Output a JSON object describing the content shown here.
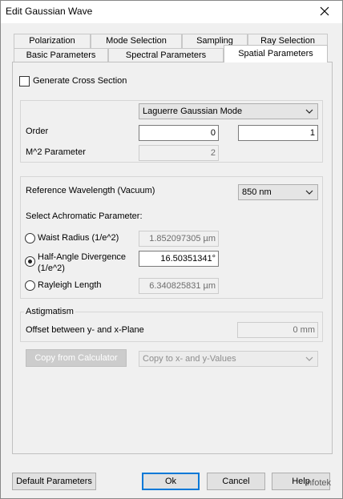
{
  "window": {
    "title": "Edit Gaussian Wave"
  },
  "tabs": {
    "row1": [
      "Polarization",
      "Mode Selection",
      "Sampling",
      "Ray Selection"
    ],
    "row2": [
      "Basic Parameters",
      "Spectral Parameters",
      "Spatial Parameters"
    ],
    "active": "Spatial Parameters"
  },
  "cross_section": {
    "label": "Generate Cross Section",
    "checked": false
  },
  "mode": {
    "selected": "Laguerre Gaussian Mode",
    "order_label": "Order",
    "order_value_1": "0",
    "order_value_2": "1",
    "m2_label": "M^2 Parameter",
    "m2_value": "2"
  },
  "wavelength": {
    "label": "Reference Wavelength (Vacuum)",
    "selected": "850 nm",
    "achromatic_label": "Select Achromatic Parameter:",
    "waist_label": "Waist Radius (1/e^2)",
    "waist_value": "1.852097305 µm",
    "divergence_label_line1": "Half-Angle Divergence",
    "divergence_label_line2": "(1/e^2)",
    "divergence_value": "16.50351341°",
    "rayleigh_label": "Rayleigh Length",
    "rayleigh_value": "6.340825831 µm",
    "selected_option": "divergence"
  },
  "astigmatism": {
    "heading": "Astigmatism",
    "offset_label": "Offset between y- and x-Plane",
    "offset_value": "0 mm"
  },
  "calculator": {
    "copy_from": "Copy from Calculator",
    "copy_to": "Copy to x- and y-Values"
  },
  "footer": {
    "default_params": "Default Parameters",
    "ok": "Ok",
    "cancel": "Cancel",
    "help": "Help"
  },
  "watermark": "Infotek"
}
